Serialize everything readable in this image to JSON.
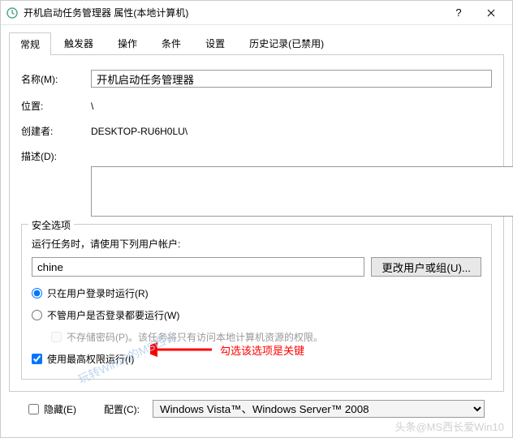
{
  "titlebar": {
    "text": "开机启动任务管理器 属性(本地计算机)"
  },
  "tabs": [
    "常规",
    "触发器",
    "操作",
    "条件",
    "设置",
    "历史记录(已禁用)"
  ],
  "form": {
    "name_label": "名称(M):",
    "name_value": "开机启动任务管理器",
    "location_label": "位置:",
    "location_value": "\\",
    "creator_label": "创建者:",
    "creator_value": "DESKTOP-RU6H0LU\\",
    "desc_label": "描述(D):"
  },
  "security": {
    "legend": "安全选项",
    "account_label": "运行任务时，请使用下列用户帐户:",
    "account_value": "chine",
    "change_user_btn": "更改用户或组(U)...",
    "radio_loggedon": "只在用户登录时运行(R)",
    "radio_not_loggedon": "不管用户是否登录都要运行(W)",
    "no_store_pwd": "不存储密码(P)。该任务将只有访问本地计算机资源的权限。",
    "highest": "使用最高权限运行(I)"
  },
  "footer": {
    "hidden": "隐藏(E)",
    "config_label": "配置(C):",
    "config_value": "Windows Vista™、Windows Server™ 2008"
  },
  "annotation": {
    "text": "勾选该选项是关键"
  },
  "watermarks": {
    "bottom": "头条@MS西长爱Win10",
    "diag": "玩转Win10的MS西长"
  }
}
